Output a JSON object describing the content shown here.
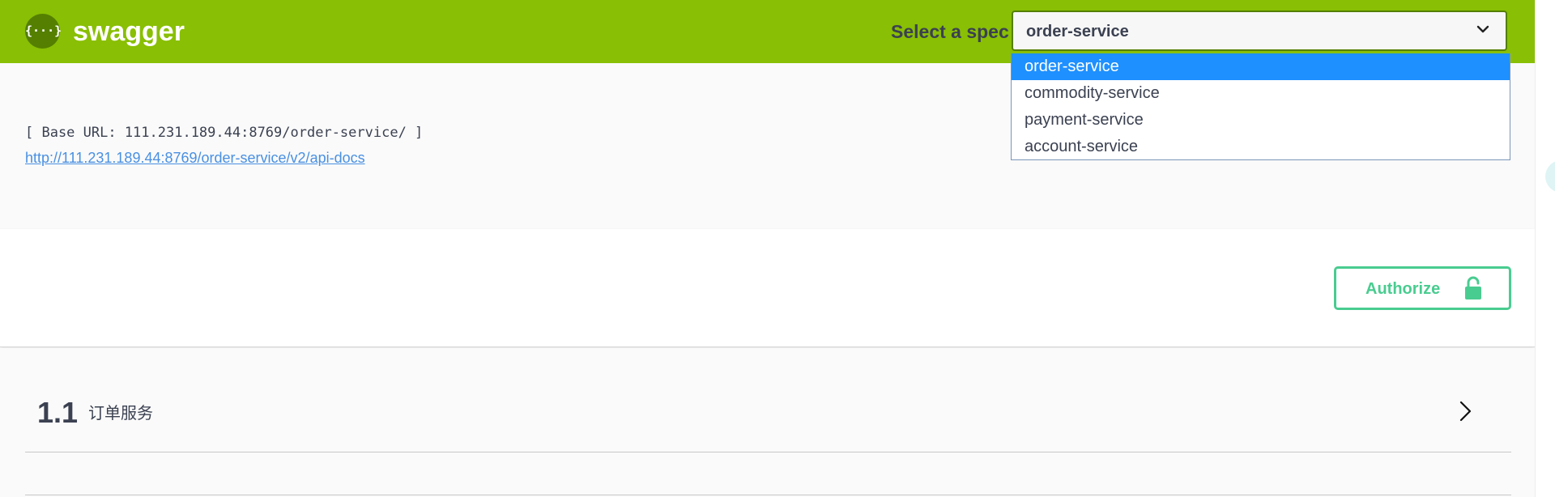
{
  "header": {
    "brand": "swagger",
    "logo_icon": "swagger-logo-icon",
    "logo_glyph": "{···}",
    "spec_label": "Select a spec",
    "spec_selected": "order-service"
  },
  "spec_dropdown": {
    "options": [
      "order-service",
      "commodity-service",
      "payment-service",
      "account-service"
    ],
    "highlighted_index": 0
  },
  "info": {
    "base_url": "[ Base URL: 111.231.189.44:8769/order-service/ ]",
    "api_docs_link": "http://111.231.189.44:8769/order-service/v2/api-docs"
  },
  "auth": {
    "authorize_label": "Authorize",
    "icon": "lock-icon"
  },
  "tags": [
    {
      "number": "1.1",
      "title": "订单服务",
      "icon": "chevron-right-icon"
    }
  ],
  "colors": {
    "topbar": "#89bf04",
    "logo_bg": "#547f00",
    "authorize": "#49cc90",
    "highlight": "#1e90ff",
    "link": "#4990e2",
    "text": "#3b4151"
  }
}
